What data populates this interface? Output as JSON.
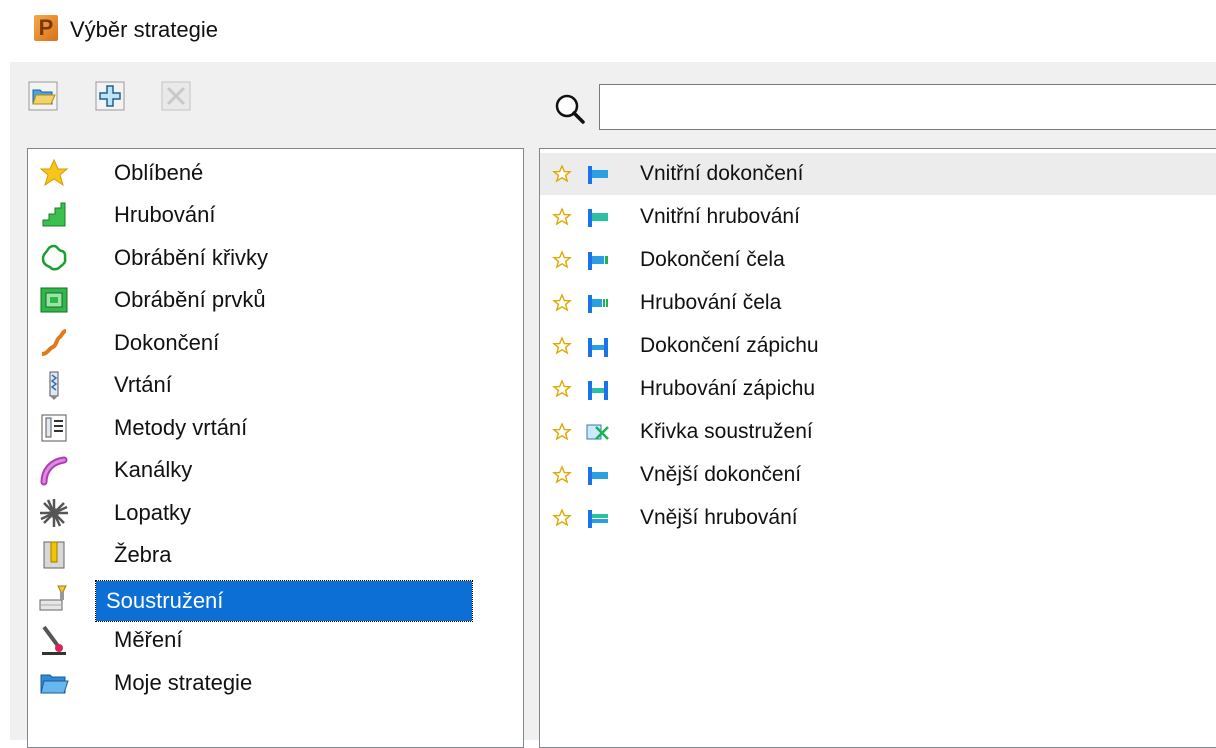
{
  "window": {
    "title": "Výběr strategie"
  },
  "toolbar": {
    "open_icon": "folder-open-icon",
    "add_icon": "add-plus-icon",
    "delete_icon": "delete-x-icon"
  },
  "search": {
    "placeholder": "",
    "value": ""
  },
  "categories": [
    {
      "label": "Oblíbené",
      "icon": "star-icon"
    },
    {
      "label": "Hrubování",
      "icon": "roughing-icon"
    },
    {
      "label": "Obrábění křivky",
      "icon": "curve-machining-icon"
    },
    {
      "label": "Obrábění prvků",
      "icon": "feature-machining-icon"
    },
    {
      "label": "Dokončení",
      "icon": "finishing-icon"
    },
    {
      "label": "Vrtání",
      "icon": "drilling-icon"
    },
    {
      "label": "Metody vrtání",
      "icon": "drilling-methods-icon"
    },
    {
      "label": "Kanálky",
      "icon": "port-icon"
    },
    {
      "label": "Lopatky",
      "icon": "blade-icon"
    },
    {
      "label": "Žebra",
      "icon": "rib-icon"
    },
    {
      "label": "Soustružení",
      "icon": "turning-icon",
      "selected": true
    },
    {
      "label": "Měření",
      "icon": "probing-icon"
    },
    {
      "label": "Moje strategie",
      "icon": "folder-icon"
    }
  ],
  "strategies": [
    {
      "label": "Vnitřní dokončení",
      "icon": "bore-finish-icon"
    },
    {
      "label": "Vnitřní hrubování",
      "icon": "bore-rough-icon"
    },
    {
      "label": "Dokončení čela",
      "icon": "face-finish-icon"
    },
    {
      "label": "Hrubování čela",
      "icon": "face-rough-icon"
    },
    {
      "label": "Dokončení zápichu",
      "icon": "groove-finish-icon"
    },
    {
      "label": "Hrubování zápichu",
      "icon": "groove-rough-icon"
    },
    {
      "label": "Křivka soustružení",
      "icon": "turn-curve-icon"
    },
    {
      "label": "Vnější dokončení",
      "icon": "outer-finish-icon"
    },
    {
      "label": "Vnější hrubování",
      "icon": "outer-rough-icon"
    }
  ],
  "colors": {
    "selection": "#0b6fd6",
    "accent_blue": "#1a73e8",
    "star": "#f2c200"
  }
}
